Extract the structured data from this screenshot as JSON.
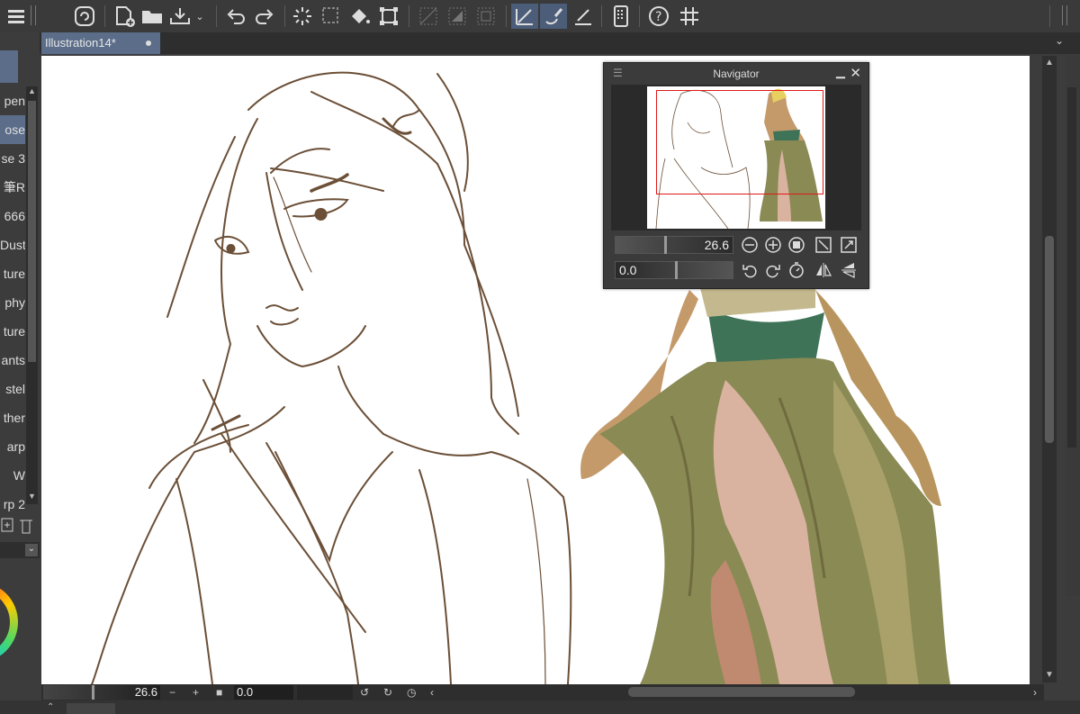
{
  "toolbar": {
    "icons": [
      "menu-icon",
      "app-logo-icon",
      "new-file-icon",
      "open-folder-icon",
      "save-icon",
      "undo-icon",
      "redo-icon",
      "loading-icon",
      "transform-icon",
      "fill-icon",
      "crop-icon",
      "snap-off-icon",
      "snap-grid-icon",
      "snap-frame-icon",
      "ruler-snap-icon",
      "brush-snap-icon",
      "pen-ruler-icon",
      "phone-icon",
      "help-icon",
      "grid-icon"
    ]
  },
  "document_tab": {
    "title": "Illustration14*"
  },
  "brushes": [
    {
      "label": "pen",
      "selected": false
    },
    {
      "label": "ose",
      "selected": true
    },
    {
      "label": "se 3",
      "selected": false
    },
    {
      "label": "筆R",
      "selected": false
    },
    {
      "label": "666",
      "selected": false
    },
    {
      "label": "Dust",
      "selected": false
    },
    {
      "label": "ture",
      "selected": false
    },
    {
      "label": "phy",
      "selected": false
    },
    {
      "label": "ture",
      "selected": false
    },
    {
      "label": "ants",
      "selected": false
    },
    {
      "label": "stel",
      "selected": false
    },
    {
      "label": "ther",
      "selected": false
    },
    {
      "label": "arp",
      "selected": false
    },
    {
      "label": "W",
      "selected": false
    },
    {
      "label": "rp 2",
      "selected": false
    }
  ],
  "navigator": {
    "title": "Navigator",
    "zoom": "26.6",
    "rotation": "0.0"
  },
  "status": {
    "zoom": "26.6",
    "rotation": "0.0"
  },
  "colors": {
    "sketch_line": "#6b4f37",
    "dress": "#8a8a55",
    "sash": "#3e7358",
    "skin": "#c49a6a",
    "accent": "#5b6d89"
  }
}
